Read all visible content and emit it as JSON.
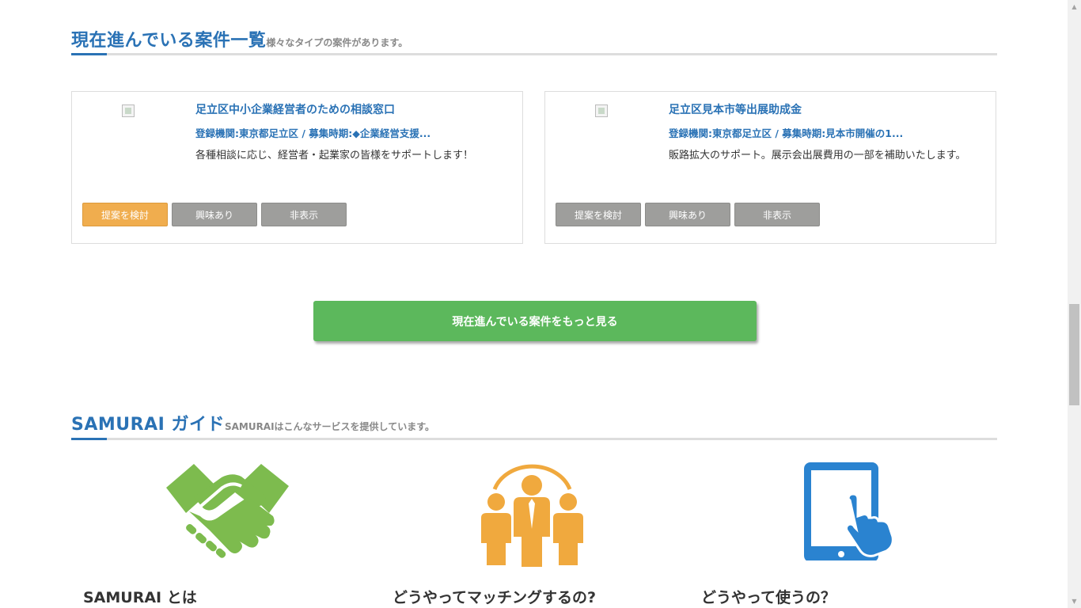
{
  "projects_section": {
    "title": "現在進んでいる案件一覧",
    "subtitle": "様々なタイプの案件があります。"
  },
  "cards": [
    {
      "name": "足立区中小企業経営者のための相談窓口",
      "meta": "登録機関:東京都足立区 / 募集時期:◆企業経営支援...",
      "desc": "各種相談に応じ、経営者・起業家の皆様をサポートします！",
      "buttons": [
        "提案を検討",
        "興味あり",
        "非表示"
      ]
    },
    {
      "name": "足立区見本市等出展助成金",
      "meta": "登録機関:東京都足立区 / 募集時期:見本市開催の1...",
      "desc": "販路拡大のサポート。展示会出展費用の一部を補助いたします。",
      "buttons": [
        "提案を検討",
        "興味あり",
        "非表示"
      ]
    }
  ],
  "more_button": "現在進んでいる案件をもっと見る",
  "guide_section": {
    "title": "SAMURAI ガイド",
    "subtitle": "SAMURAIはこんなサービスを提供しています。",
    "items": [
      {
        "title": "SAMURAI とは",
        "icon": "handshake-icon"
      },
      {
        "title": "どうやってマッチングするの?",
        "icon": "people-icon"
      },
      {
        "title": "どうやって使うの？",
        "icon": "tablet-touch-icon"
      }
    ]
  },
  "colors": {
    "accent_blue": "#2a72b5",
    "primary_orange": "#f0ad4e",
    "gray_button": "#9e9e9c",
    "green_button": "#5cb85c",
    "handshake_green": "#7dbb4e",
    "people_orange": "#f0a93e",
    "tablet_blue": "#2a83d0"
  }
}
